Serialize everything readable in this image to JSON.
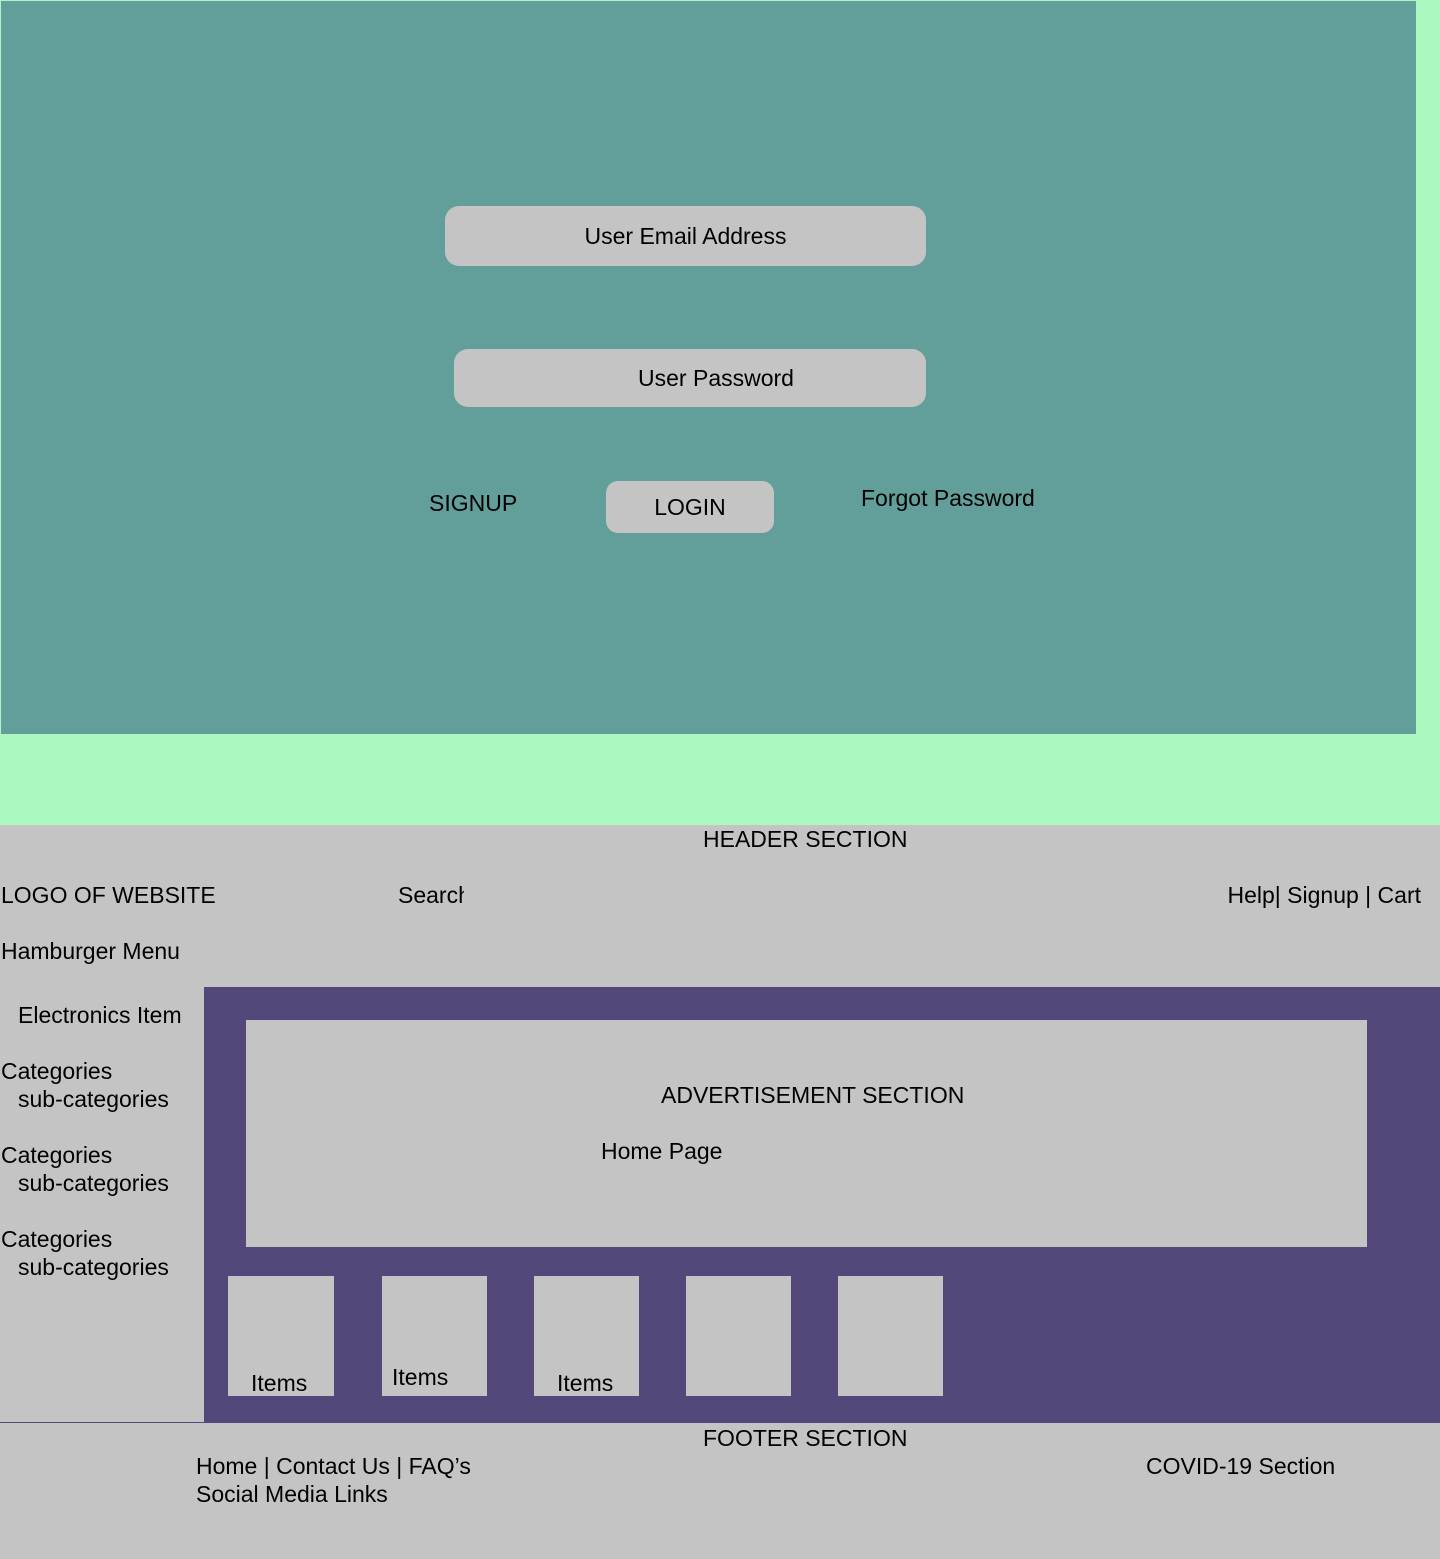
{
  "login": {
    "email_placeholder": "User Email Address",
    "password_placeholder": "User Password",
    "signup_label": "SIGNUP",
    "login_label": "LOGIN",
    "forgot_label": "Forgot Password"
  },
  "header": {
    "section_title": "HEADER SECTION",
    "logo_text": "LOGO OF WEBSITE",
    "search_text": "Search",
    "top_links": "Help| Signup |  Cart",
    "hamburger": "Hamburger Menu"
  },
  "sidebar": {
    "title": "Electronics Item",
    "groups": [
      {
        "category": "Categories",
        "subcategory": "sub-categories"
      },
      {
        "category": "Categories",
        "subcategory": "sub-categories"
      },
      {
        "category": "Categories",
        "subcategory": "sub-categories"
      }
    ]
  },
  "main": {
    "ad_title": "ADVERTISEMENT SECTION",
    "home_page_label": "Home Page",
    "items": [
      {
        "label": "Items"
      },
      {
        "label": "Items"
      },
      {
        "label": "Items"
      },
      {
        "label": ""
      },
      {
        "label": ""
      }
    ]
  },
  "footer": {
    "section_title": "FOOTER SECTION",
    "links": "Home | Contact Us | FAQ’s",
    "social": "Social Media Links",
    "covid": "COVID-19 Section"
  },
  "colors": {
    "frame_green": "#abf9c1",
    "login_teal": "#629e9a",
    "gray": "#c4c4c4",
    "purple": "#54477a"
  }
}
